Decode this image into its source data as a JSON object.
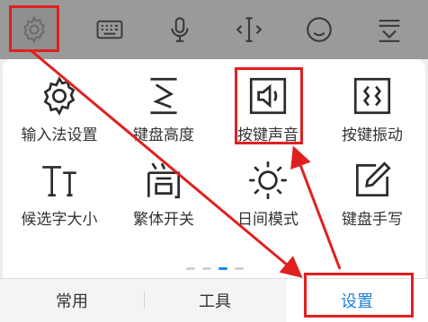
{
  "toolbar": {
    "icons": [
      "gear-icon",
      "keyboard-icon",
      "microphone-icon",
      "cursor-icon",
      "emoji-icon",
      "collapse-keyboard-icon"
    ]
  },
  "settings_grid": {
    "items": [
      {
        "label": "输入法设置",
        "icon": "gear-icon"
      },
      {
        "label": "键盘高度",
        "icon": "keyboard-height-icon"
      },
      {
        "label": "按键声音",
        "icon": "key-sound-icon"
      },
      {
        "label": "按键振动",
        "icon": "key-vibration-icon"
      },
      {
        "label": "候选字大小",
        "icon": "candidate-size-icon"
      },
      {
        "label": "繁体开关",
        "icon": "traditional-chinese-icon"
      },
      {
        "label": "日间模式",
        "icon": "sun-icon"
      },
      {
        "label": "键盘手写",
        "icon": "handwriting-icon"
      }
    ]
  },
  "pager": {
    "pages": 4,
    "active": 3
  },
  "tabs": [
    {
      "label": "常用",
      "active": false
    },
    {
      "label": "工具",
      "active": false
    },
    {
      "label": "设置",
      "active": true
    }
  ],
  "colors": {
    "accent": "#1e88e5",
    "highlight": "#e02020",
    "toolbar_bg": "#9a9a9a",
    "panel_bg": "#ffffff"
  }
}
